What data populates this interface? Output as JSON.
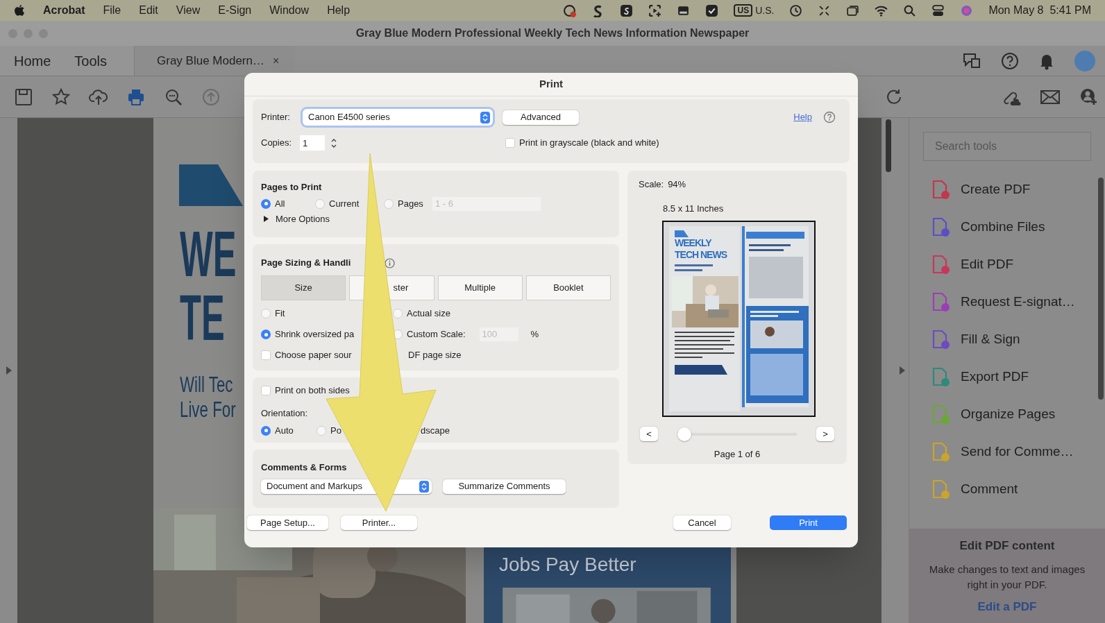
{
  "menu_bar": {
    "app": "Acrobat",
    "items": [
      "File",
      "Edit",
      "View",
      "E-Sign",
      "Window",
      "Help"
    ],
    "keyboard_badge": "US",
    "keyboard_label": "U.S.",
    "clock": "Mon May 8  5:41 PM"
  },
  "window": {
    "title": "Gray Blue Modern Professional Weekly Tech News Information Newspaper"
  },
  "nav_tabs": [
    "Home",
    "Tools"
  ],
  "document_tab": {
    "label": "Gray Blue Modern…",
    "close": "×"
  },
  "document": {
    "headline": [
      "WE",
      "TE"
    ],
    "subtitle": [
      "Will Tec",
      "Live For"
    ],
    "caption": "Jobs Pay Better"
  },
  "tools_panel": {
    "search": {
      "placeholder": "Search tools"
    },
    "items": [
      {
        "label": "Create PDF",
        "color": "#c0394b"
      },
      {
        "label": "Combine Files",
        "color": "#5b4fc4"
      },
      {
        "label": "Edit PDF",
        "color": "#c8375a"
      },
      {
        "label": "Request E-signat…",
        "color": "#9b3fb5"
      },
      {
        "label": "Fill & Sign",
        "color": "#6c4cc0"
      },
      {
        "label": "Export PDF",
        "color": "#2e8a7a"
      },
      {
        "label": "Organize Pages",
        "color": "#6aa832"
      },
      {
        "label": "Send for Comme…",
        "color": "#c9a52b"
      },
      {
        "label": "Comment",
        "color": "#c9a52b"
      }
    ],
    "promo": {
      "title": "Edit PDF content",
      "text": "Make changes to text and images right in your PDF.",
      "link": "Edit a PDF"
    }
  },
  "print_dialog": {
    "title": "Print",
    "printer": {
      "label": "Printer:",
      "value": "Canon E4500 series"
    },
    "advanced": "Advanced",
    "help": "Help",
    "copies": {
      "label": "Copies:",
      "value": "1"
    },
    "grayscale": {
      "label": "Print in grayscale (black and white)",
      "checked": false
    },
    "pages_to_print": {
      "heading": "Pages to Print",
      "options": [
        {
          "label": "All",
          "selected": true
        },
        {
          "label": "Current",
          "selected": false
        },
        {
          "label": "Pages",
          "selected": false
        }
      ],
      "range": "1 - 6",
      "more": "More Options"
    },
    "page_sizing": {
      "heading": "Page Sizing & Handli",
      "modes": [
        {
          "label": "Size",
          "selected": true
        },
        {
          "label": "ster",
          "selected": false
        },
        {
          "label": "Multiple",
          "selected": false
        },
        {
          "label": "Booklet",
          "selected": false
        }
      ],
      "options": [
        {
          "label": "Fit",
          "selected": false
        },
        {
          "label": "Actual size",
          "selected": false
        },
        {
          "label": "Shrink oversized pa",
          "selected": true
        },
        {
          "label": "Custom Scale:",
          "selected": false
        }
      ],
      "scale": "100",
      "percent": "%",
      "paper_source": {
        "label_parts": [
          "Choose paper sour",
          "DF page size"
        ],
        "checked": false
      }
    },
    "duplex": {
      "label": "Print on both sides",
      "checked": false
    },
    "orientation": {
      "label": "Orientation:",
      "options": [
        {
          "label": "Auto",
          "selected": true
        },
        {
          "label": "Po",
          "selected": false
        },
        {
          "label": "dscape"
        }
      ]
    },
    "comments": {
      "heading": "Comments & Forms",
      "value": "Document and Markups",
      "summarize": "Summarize Comments"
    },
    "preview": {
      "scale_label": "Scale:",
      "scale": "94%",
      "paper": "8.5 x 11 Inches",
      "thumbnail": {
        "headline": [
          "WEEKLY",
          "TECH NEWS"
        ]
      },
      "prev": "<",
      "next": ">",
      "slider": {
        "level": 0
      },
      "page": "Page 1 of 6"
    },
    "buttons": {
      "page_setup": "Page Setup...",
      "printer": "Printer...",
      "cancel": "Cancel",
      "print": "Print"
    }
  }
}
